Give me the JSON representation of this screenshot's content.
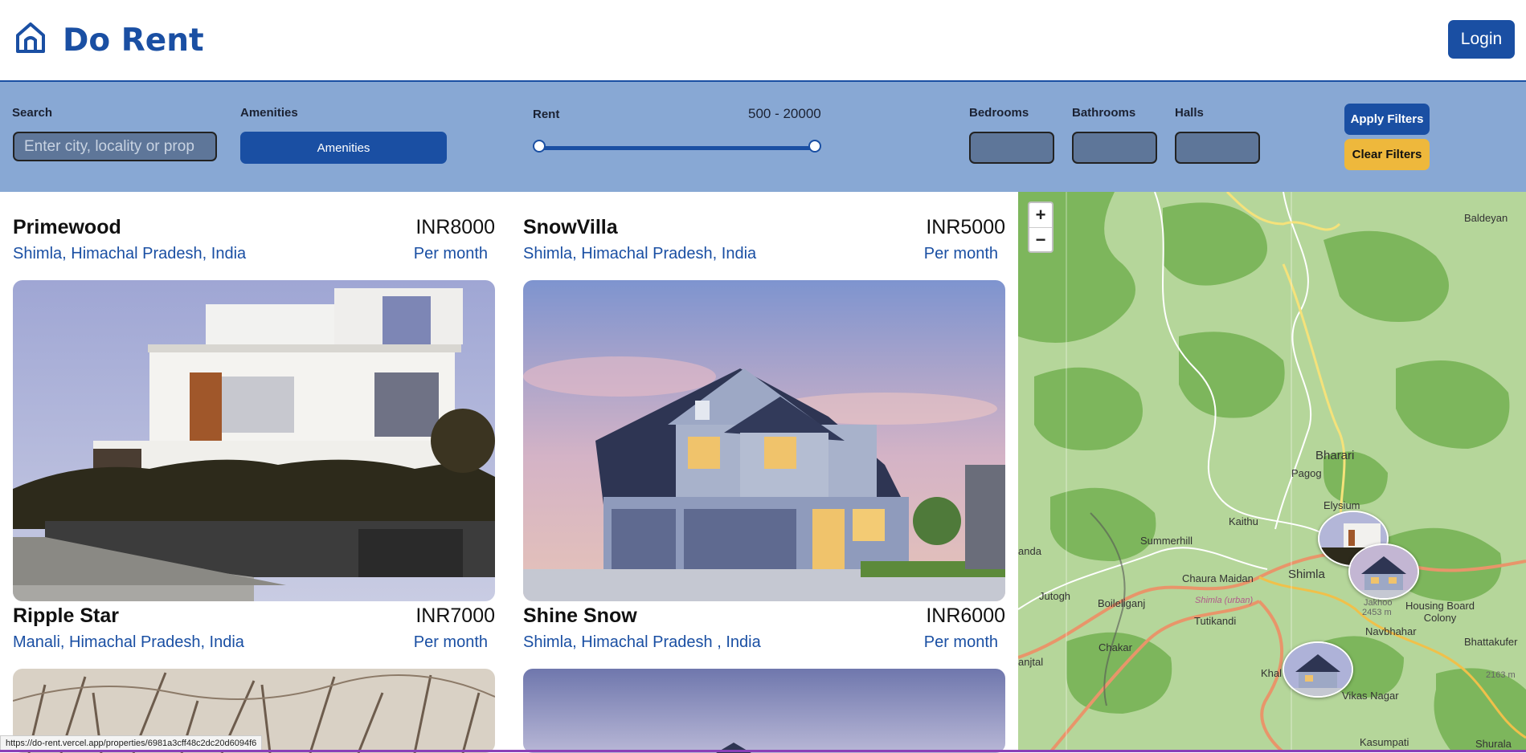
{
  "header": {
    "brand": "Do Rent",
    "login_label": "Login",
    "logo_icon": "home-icon",
    "accent_color": "#1a4fa3"
  },
  "filters": {
    "search_label": "Search",
    "search_placeholder": "Enter city, locality or prop",
    "amenities_label": "Amenities",
    "amenities_button": "Amenities",
    "rent_label": "Rent",
    "rent_range_text": "500 - 20000",
    "rent_min": 500,
    "rent_max": 20000,
    "bedrooms_label": "Bedrooms",
    "bathrooms_label": "Bathrooms",
    "halls_label": "Halls",
    "apply_label": "Apply Filters",
    "clear_label": "Clear Filters"
  },
  "listings": [
    {
      "name": "Primewood",
      "location": "Shimla, Himachal Pradesh, India",
      "price": "INR8000",
      "period": "Per month"
    },
    {
      "name": "SnowVilla",
      "location": "Shimla, Himachal Pradesh, India",
      "price": "INR5000",
      "period": "Per month"
    },
    {
      "name": "Ripple Star",
      "location": "Manali, Himachal Pradesh, India",
      "price": "INR7000",
      "period": "Per month"
    },
    {
      "name": "Shine Snow",
      "location": "Shimla, Himachal Pradesh , India",
      "price": "INR6000",
      "period": "Per month"
    }
  ],
  "map": {
    "zoom_in": "+",
    "zoom_out": "−",
    "places": [
      "Baldeyan",
      "Bharari",
      "Pagog",
      "Elysium",
      "Kaithu",
      "Summerhill",
      "Chaura Maidan",
      "Shimla",
      "Jutogh",
      "Boileliganj",
      "Tutikandi",
      "Shimla (urban)",
      "Jakhoo",
      "2453 m",
      "Housing Board Colony",
      "Navbhahar",
      "Bhattakufer",
      "Chakar",
      "Khal",
      "Vikas Nagar",
      "Kasumpati",
      "Shurala",
      "2163 m",
      "anda",
      "anjtal"
    ]
  },
  "status_url": "https://do-rent.vercel.app/properties/6981a3cff48c2dc20d6094f6"
}
